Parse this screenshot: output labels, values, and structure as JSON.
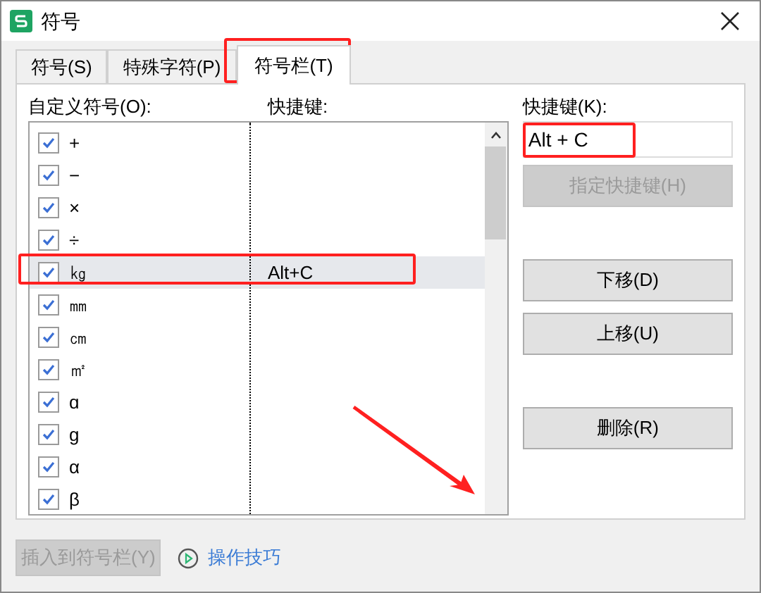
{
  "window": {
    "title": "符号"
  },
  "tabs": [
    {
      "label": "符号(S)",
      "selected": false
    },
    {
      "label": "特殊字符(P)",
      "selected": false
    },
    {
      "label": "符号栏(T)",
      "selected": true
    }
  ],
  "list": {
    "label": "自定义符号(O):",
    "shortcut_header": "快捷键:",
    "rows": [
      {
        "symbol": "+",
        "shortcut": "",
        "checked": true,
        "selected": false
      },
      {
        "symbol": "−",
        "shortcut": "",
        "checked": true,
        "selected": false
      },
      {
        "symbol": "×",
        "shortcut": "",
        "checked": true,
        "selected": false
      },
      {
        "symbol": "÷",
        "shortcut": "",
        "checked": true,
        "selected": false
      },
      {
        "symbol": "㎏",
        "shortcut": "Alt+C",
        "checked": true,
        "selected": true
      },
      {
        "symbol": "㎜",
        "shortcut": "",
        "checked": true,
        "selected": false
      },
      {
        "symbol": "㎝",
        "shortcut": "",
        "checked": true,
        "selected": false
      },
      {
        "symbol": "㎡",
        "shortcut": "",
        "checked": true,
        "selected": false
      },
      {
        "symbol": "ɑ",
        "shortcut": "",
        "checked": true,
        "selected": false
      },
      {
        "symbol": "g",
        "shortcut": "",
        "checked": true,
        "selected": false
      },
      {
        "symbol": "α",
        "shortcut": "",
        "checked": true,
        "selected": false
      },
      {
        "symbol": "β",
        "shortcut": "",
        "checked": true,
        "selected": false
      }
    ]
  },
  "shortcut_field": {
    "label": "快捷键(K):",
    "value": "Alt + C"
  },
  "side_buttons": [
    {
      "label": "指定快捷键(H)",
      "disabled": true
    },
    {
      "label": "下移(D)",
      "disabled": false
    },
    {
      "label": "上移(U)",
      "disabled": false
    },
    {
      "label": "删除(R)",
      "disabled": false
    }
  ],
  "insert_button": {
    "label": "插入到符号栏(Y)",
    "disabled": true
  },
  "tips_link": "操作技巧"
}
